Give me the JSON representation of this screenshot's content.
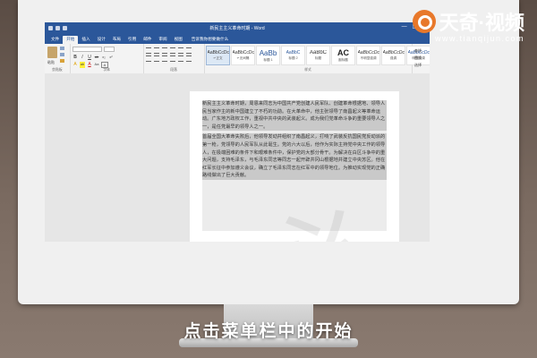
{
  "window": {
    "title": "新民主主义革命时期 - Word",
    "controls": [
      "—",
      "☐",
      "✕"
    ]
  },
  "tabs": [
    {
      "label": "文件"
    },
    {
      "label": "开始",
      "active": true
    },
    {
      "label": "插入"
    },
    {
      "label": "设计"
    },
    {
      "label": "布局"
    },
    {
      "label": "引用"
    },
    {
      "label": "邮件"
    },
    {
      "label": "审阅"
    },
    {
      "label": "视图"
    }
  ],
  "tellme": "告诉我你想要做什么",
  "ribbon": {
    "clipboard": {
      "paste_label": "粘贴",
      "group_label": "剪贴板"
    },
    "font": {
      "font_name": "",
      "font_size": "",
      "row1": [
        "B",
        "I",
        "U",
        "ab",
        "x₂",
        "x²"
      ],
      "row2": [
        "A",
        "ab",
        "A",
        "Aa",
        "A"
      ],
      "group_label": "字体"
    },
    "paragraph": {
      "group_label": "段落"
    },
    "styles": {
      "items": [
        {
          "sample": "AaBbCcDc",
          "name": "↵正文",
          "selected": true
        },
        {
          "sample": "AaBbCcDc",
          "name": "↵无间隔"
        },
        {
          "sample": "AaBb",
          "name": "标题 1",
          "big": true
        },
        {
          "sample": "AaBbC",
          "name": "标题 2"
        },
        {
          "sample": "AaBbC",
          "name": "标题"
        },
        {
          "sample": "AC",
          "name": "副标题",
          "mc": true
        },
        {
          "sample": "AaBbCcDc",
          "name": "不明显强调"
        },
        {
          "sample": "AaBbCcDc",
          "name": "强调"
        },
        {
          "sample": "AaBbCcDc",
          "name": "明显强调"
        }
      ],
      "group_label": "样式"
    },
    "editing": {
      "items": [
        "查找",
        "替换",
        "选择"
      ]
    }
  },
  "document": {
    "para1": "新民主主义革命时期，周恩来同志为中国共产党创建人民军队、创建革命根据地、领导人民当家作主的新中国建立了不朽的功勋。在大革命中，他主张领导了南昌起义等革命运动。广东地方政权工作，重视中共中央的武装起义。成为我们党革命斗争的重要领导人之一，是任党最早的领导人之一。",
    "para2": "首届全国大革命失败后，他领导发动并组织了南昌起义，打响了武装反抗国民党反动派的第一枪，党领导的人民军队从此诞生。党的六大以后，他作为实际主持党中央工作的领导人，在极端困难的条件下和艰难条件中，保护党的大部分骨干。为解决在白区斗争中的重大问题，支持毛泽东，与毛泽东同志等同志一起开辟井冈山根据地并建立中央苏区。他在红军长征中参加遵义会议，确立了毛泽东同志在红军中的领导地位。为推动实现党的正确路线做出了巨大贡献。"
  },
  "brand": {
    "name": "天奇·视频",
    "url": "www.tianqijun.com"
  },
  "caption": "点击菜单栏中的开始"
}
